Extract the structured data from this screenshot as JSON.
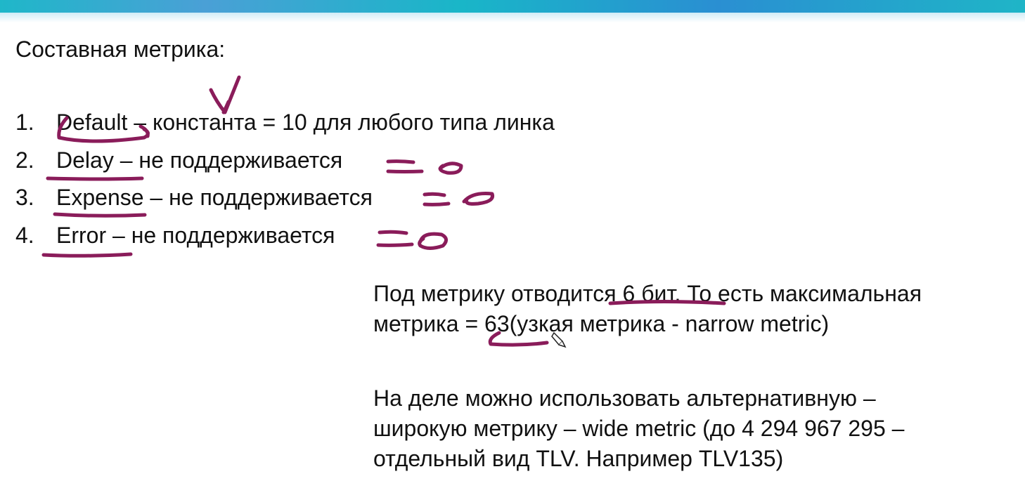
{
  "slide": {
    "title": "Составная метрика:",
    "items": [
      {
        "num": "1.",
        "name": "Default",
        "desc": " – константа = 10 для любого типа линка"
      },
      {
        "num": "2.",
        "name": "Delay",
        "desc": " – не поддерживается"
      },
      {
        "num": "3.",
        "name": "Expense",
        "desc": " – не поддерживается"
      },
      {
        "num": "4.",
        "name": "Error",
        "desc": " – не поддерживается"
      }
    ],
    "para1": {
      "line1": "Под метрику отводится 6 бит. То есть максимальная",
      "line2": "метрика = 63(узкая метрика - narrow metric)"
    },
    "para2": {
      "line1": "На деле можно использовать альтернативную –",
      "line2": "широкую метрику – wide metric (до  4 294 967 295 –",
      "line3": "отдельный вид TLV. Например TLV135)"
    }
  },
  "colors": {
    "ink": "#8a1c5a",
    "header_band": "#1fb7c9",
    "text": "#111111"
  }
}
